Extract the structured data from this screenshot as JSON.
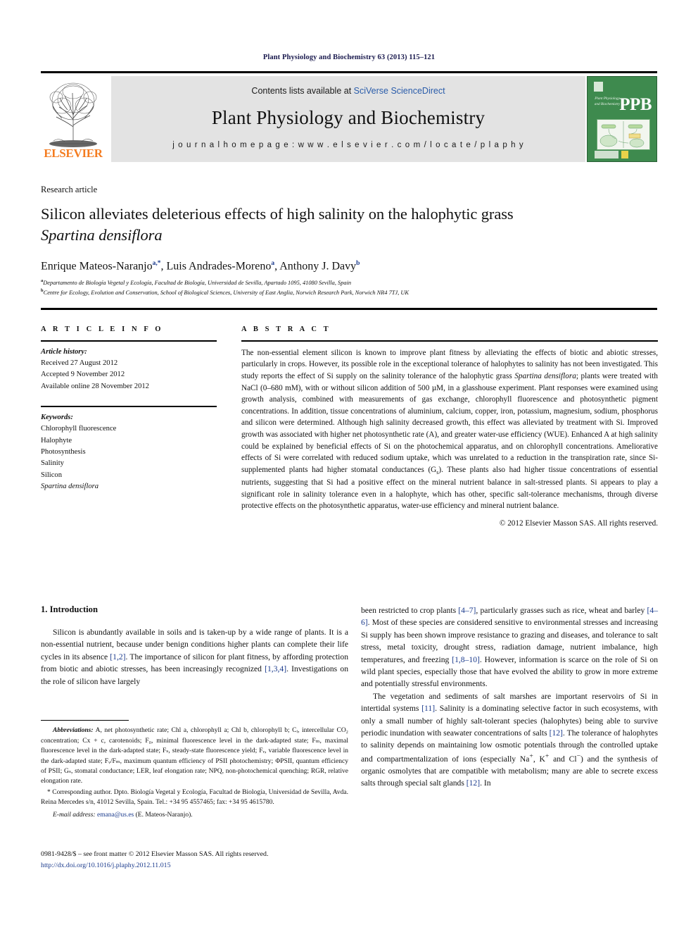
{
  "running_head": "Plant Physiology and Biochemistry 63 (2013) 115–121",
  "masthead": {
    "publisher_logo_name": "elsevier-tree-logo",
    "publisher_wordmark": "ELSEVIER",
    "contents_prefix": "Contents lists available at ",
    "contents_link": "SciVerse ScienceDirect",
    "journal_title": "Plant Physiology and Biochemistry",
    "homepage": "j o u r n a l    h o m e p a g e :   w w w . e l s e v i e r . c o m / l o c a t e / p l a p h y",
    "cover": {
      "abbrev": "PPB",
      "subtitle": "Plant Physiology and Biochemistry",
      "subtitle_lines": [
        "Plant",
        "Physiology",
        "and",
        "Biochemistry"
      ]
    },
    "colors": {
      "banner_bg": "#e3e3e3",
      "link": "#2a5caa",
      "elsevier_orange": "#f47c20",
      "cover_green": "#3e8a4e"
    }
  },
  "article": {
    "type": "Research article",
    "title_line1": "Silicon alleviates deleterious effects of high salinity on the halophytic grass",
    "title_species": "Spartina densiflora",
    "authors": [
      {
        "name": "Enrique Mateos-Naranjo",
        "marks": "a,*"
      },
      {
        "name": "Luis Andrades-Moreno",
        "marks": "a"
      },
      {
        "name": "Anthony J. Davy",
        "marks": "b"
      }
    ],
    "affiliations": [
      {
        "mark": "a",
        "text": "Departamento de Biología Vegetal y Ecología, Facultad de Biología, Universidad de Sevilla, Apartado 1095, 41080 Sevilla, Spain"
      },
      {
        "mark": "b",
        "text": "Centre for Ecology, Evolution and Conservation, School of Biological Sciences, University of East Anglia, Norwich Research Park, Norwich NR4 7TJ, UK"
      }
    ]
  },
  "article_info": {
    "heading": "A R T I C L E    I N F O",
    "history_heading": "Article history:",
    "history": [
      "Received 27 August 2012",
      "Accepted 9 November 2012",
      "Available online 28 November 2012"
    ],
    "keywords_heading": "Keywords:",
    "keywords": [
      "Chlorophyll fluorescence",
      "Halophyte",
      "Photosynthesis",
      "Salinity",
      "Silicon"
    ],
    "keyword_italic": "Spartina densiflora"
  },
  "abstract": {
    "heading": "A B S T R A C T",
    "part1": "The non-essential element silicon is known to improve plant fitness by alleviating the effects of biotic and abiotic stresses, particularly in crops. However, its possible role in the exceptional tolerance of halophytes to salinity has not been investigated. This study reports the effect of Si supply on the salinity tolerance of the halophytic grass ",
    "species": "Spartina densiflora",
    "part2": "; plants were treated with NaCl (0–680 mM), with or without silicon addition of 500 µM, in a glasshouse experiment. Plant responses were examined using growth analysis, combined with measurements of gas exchange, chlorophyll fluorescence and photosynthetic pigment concentrations. In addition, tissue concentrations of aluminium, calcium, copper, iron, potassium, magnesium, sodium, phosphorus and silicon were determined. Although high salinity decreased growth, this effect was alleviated by treatment with Si. Improved growth was associated with higher net photosynthetic rate (A), and greater water-use efficiency (WUE). Enhanced A at high salinity could be explained by beneficial effects of Si on the photochemical apparatus, and on chlorophyll concentrations. Ameliorative effects of Si were correlated with reduced sodium uptake, which was unrelated to a reduction in the transpiration rate, since Si-supplemented plants had higher stomatal conductances (G",
    "part2_sub": "s",
    "part3": "). These plants also had higher tissue concentrations of essential nutrients, suggesting that Si had a positive effect on the mineral nutrient balance in salt-stressed plants. Si appears to play a significant role in salinity tolerance even in a halophyte, which has other, specific salt-tolerance mechanisms, through diverse protective effects on the photosynthetic apparatus, water-use efficiency and mineral nutrient balance.",
    "copyright": "© 2012 Elsevier Masson SAS. All rights reserved."
  },
  "introduction": {
    "heading": "1. Introduction",
    "left_para": {
      "seg1": "Silicon is abundantly available in soils and is taken-up by a wide range of plants. It is a non-essential nutrient, because under benign conditions higher plants can complete their life cycles in its absence ",
      "ref1": "[1,2]",
      "seg2": ". The importance of silicon for plant fitness, by affording protection from biotic and abiotic stresses, has been increasingly recognized ",
      "ref2": "[1,3,4]",
      "seg3": ". Investigations on the role of silicon have largely"
    },
    "right_para1": {
      "seg1": "been restricted to crop plants ",
      "ref1": "[4–7]",
      "seg2": ", particularly grasses such as rice, wheat and barley ",
      "ref2": "[4–6]",
      "seg3": ". Most of these species are considered sensitive to environmental stresses and increasing Si supply has been shown improve resistance to grazing and diseases, and tolerance to salt stress, metal toxicity, drought stress, radiation damage, nutrient imbalance, high temperatures, and freezing ",
      "ref3": "[1,8–10]",
      "seg4": ". However, information is scarce on the role of Si on wild plant species, especially those that have evolved the ability to grow in more extreme and potentially stressful environments."
    },
    "right_para2": {
      "seg1": "The vegetation and sediments of salt marshes are important reservoirs of Si in intertidal systems ",
      "ref1": "[11]",
      "seg2": ". Salinity is a dominating selective factor in such ecosystems, with only a small number of highly salt-tolerant species (halophytes) being able to survive periodic inundation with seawater concentrations of salts ",
      "ref2": "[12]",
      "seg3": ". The tolerance of halophytes to salinity depends on maintaining low osmotic potentials through the controlled uptake and compartmentalization of ions (especially Na",
      "sup1": "+",
      "seg4": ", K",
      "sup2": "+",
      "seg5": " and Cl",
      "sup3": "−",
      "seg6": ") and the synthesis of organic osmolytes that are compatible with metabolism; many are able to secrete excess salts through special salt glands ",
      "ref3": "[12]",
      "seg7": ". In"
    }
  },
  "footnotes": {
    "abbrev_label": "Abbreviations:",
    "abbrev_text": " A, net photosynthetic rate; Chl a, chlorophyll a; Chl b, chlorophyll b; Cᵢ, intercellular CO₂ concentration; Cx + c, carotenoids; F₀, minimal fluorescence level in the dark-adapted state; Fₘ, maximal fluorescence level in the dark-adapted state; Fₛ, steady-state fluorescence yield; Fᵥ, variable fluorescence level in the dark-adapted state; Fᵥ/Fₘ, maximum quantum efficiency of PSII photochemistry; ΦPSII, quantum efficiency of PSII; Gₛ, stomatal conductance; LER, leaf elongation rate; NPQ, non-photochemical quenching; RGR, relative elongation rate.",
    "corresponding": "* Corresponding author. Dpto. Biología Vegetal y Ecología, Facultad de Biología, Universidad de Sevilla, Avda. Reina Mercedes s/n, 41012 Sevilla, Spain. Tel.: +34 95 4557465; fax: +34 95 4615780.",
    "email_label": "E-mail address:",
    "email": "emana@us.es",
    "email_attrib": " (E. Mateos-Naranjo)."
  },
  "footer": {
    "issn_line": "0981-9428/$ – see front matter © 2012 Elsevier Masson SAS. All rights reserved.",
    "doi": "http://dx.doi.org/10.1016/j.plaphy.2012.11.015"
  }
}
